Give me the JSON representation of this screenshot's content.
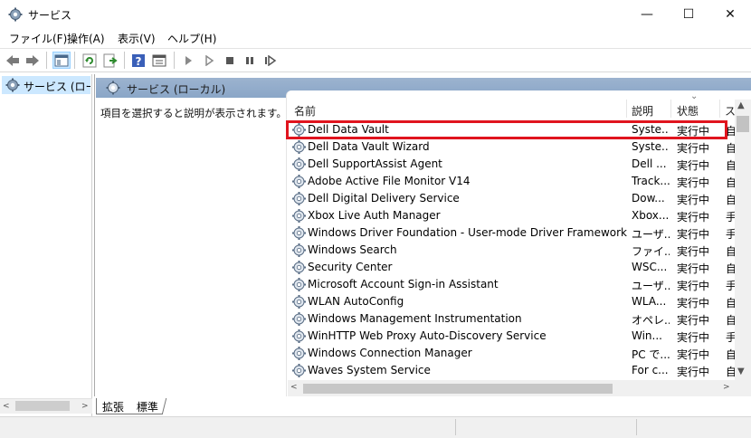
{
  "window": {
    "title": "サービス",
    "minimize_glyph": "—",
    "maximize_glyph": "☐",
    "close_glyph": "✕"
  },
  "menu": [
    "ファイル(F)",
    "操作(A)",
    "表示(V)",
    "ヘルプ(H)"
  ],
  "toolbar": {
    "icons": [
      "back-icon",
      "forward-icon",
      "show-hide-tree-icon",
      "refresh-icon",
      "export-list-icon",
      "help-icon",
      "properties-icon",
      "start-service-icon",
      "start-service-alt-icon",
      "stop-service-icon",
      "pause-service-icon",
      "restart-service-icon"
    ]
  },
  "tree": {
    "root_label": "サービス (ローカル"
  },
  "main": {
    "header": "サービス (ローカル)",
    "description_prompt": "項目を選択すると説明が表示されます。"
  },
  "table": {
    "columns": [
      "名前",
      "説明",
      "状態",
      "ス"
    ],
    "sort_indicator": "⌄",
    "highlighted_row": 0,
    "rows": [
      {
        "name": "Dell Data Vault",
        "desc": "Syste...",
        "status": "実行中",
        "start": "自"
      },
      {
        "name": "Dell Data Vault Wizard",
        "desc": "Syste...",
        "status": "実行中",
        "start": "自"
      },
      {
        "name": "Dell SupportAssist Agent",
        "desc": "Dell ...",
        "status": "実行中",
        "start": "自"
      },
      {
        "name": "Adobe Active File Monitor V14",
        "desc": "Track...",
        "status": "実行中",
        "start": "自"
      },
      {
        "name": "Dell Digital Delivery Service",
        "desc": "Dow...",
        "status": "実行中",
        "start": "自"
      },
      {
        "name": "Xbox Live Auth Manager",
        "desc": "Xbox...",
        "status": "実行中",
        "start": "手"
      },
      {
        "name": "Windows Driver Foundation - User-mode Driver Framework",
        "desc": "ユーザ...",
        "status": "実行中",
        "start": "手"
      },
      {
        "name": "Windows Search",
        "desc": "ファイ...",
        "status": "実行中",
        "start": "自"
      },
      {
        "name": "Security Center",
        "desc": "WSC...",
        "status": "実行中",
        "start": "自"
      },
      {
        "name": "Microsoft Account Sign-in Assistant",
        "desc": "ユーザ...",
        "status": "実行中",
        "start": "手"
      },
      {
        "name": "WLAN AutoConfig",
        "desc": "WLA...",
        "status": "実行中",
        "start": "自"
      },
      {
        "name": "Windows Management Instrumentation",
        "desc": "オペレ...",
        "status": "実行中",
        "start": "自"
      },
      {
        "name": "WinHTTP Web Proxy Auto-Discovery Service",
        "desc": "Win...",
        "status": "実行中",
        "start": "手"
      },
      {
        "name": "Windows Connection Manager",
        "desc": "PC で...",
        "status": "実行中",
        "start": "自"
      },
      {
        "name": "Waves System Service",
        "desc": "For c...",
        "status": "実行中",
        "start": "自"
      }
    ]
  },
  "tabs": [
    "拡張",
    "標準"
  ],
  "colors": {
    "highlight_border": "#e0141e",
    "pane_header": "#9cb3cf",
    "tree_selection": "#cce8ff"
  }
}
